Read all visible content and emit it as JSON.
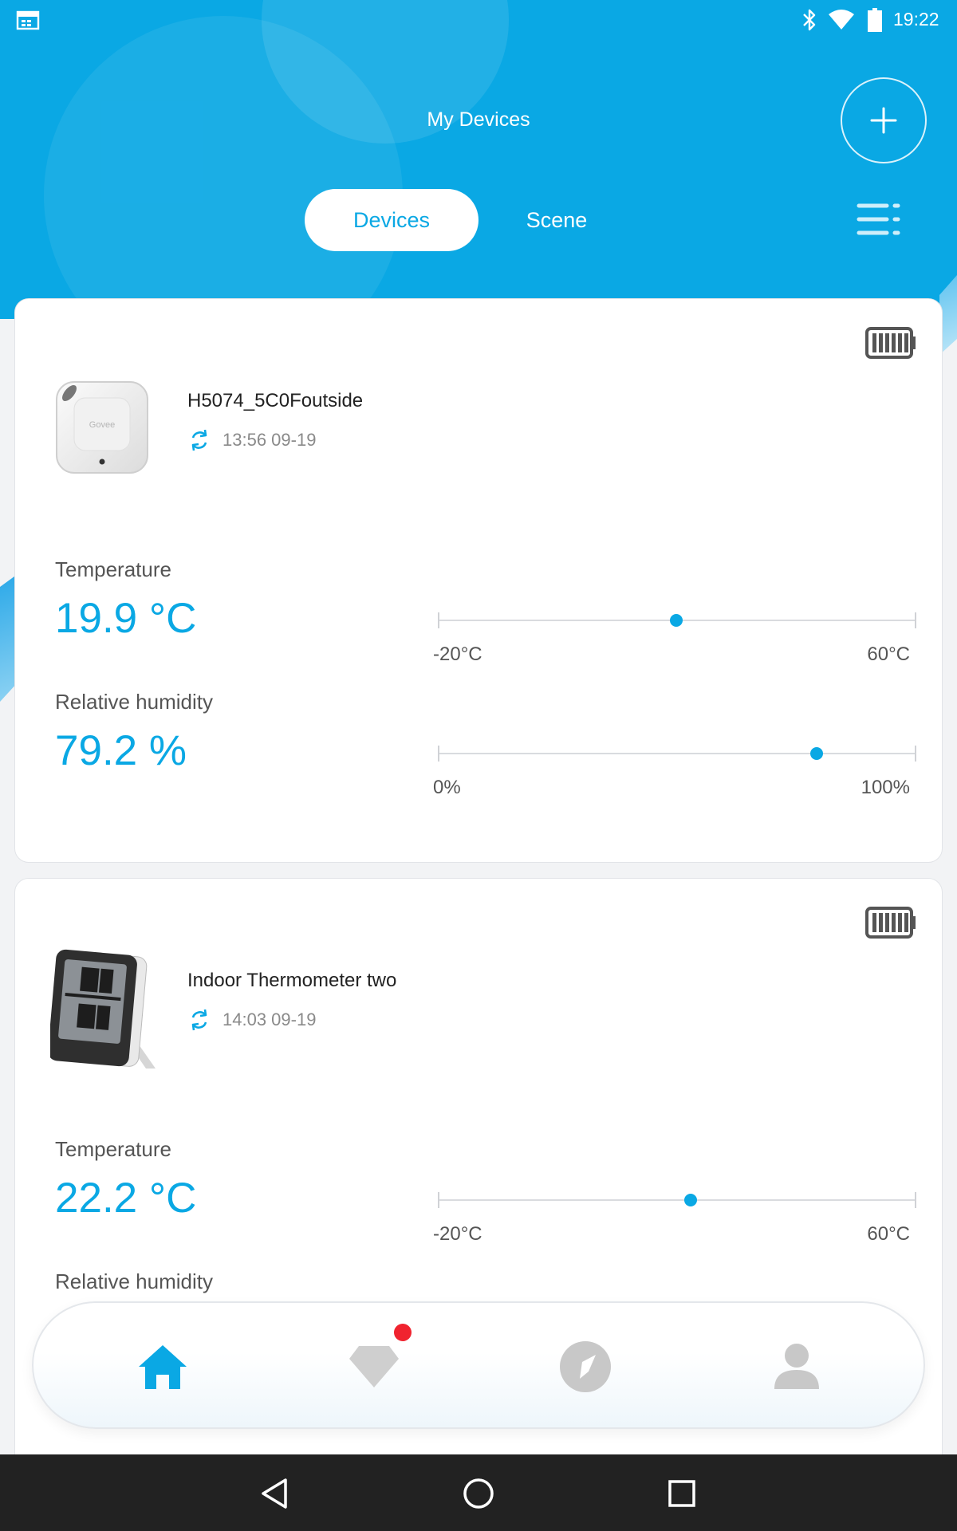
{
  "status_bar": {
    "time": "19:22",
    "icons": [
      "calendar-icon",
      "bluetooth-icon",
      "wifi-icon",
      "battery-icon"
    ]
  },
  "header": {
    "title": "My Devices",
    "add_icon": "plus-icon",
    "menu_icon": "list-menu-icon",
    "tabs": [
      {
        "label": "Devices",
        "active": true
      },
      {
        "label": "Scene",
        "active": false
      }
    ]
  },
  "devices": [
    {
      "name": "H5074_5C0Foutside",
      "sync_time": "13:56 09-19",
      "battery_icon": "battery-full-icon",
      "thumb_label": "Govee",
      "temperature": {
        "label": "Temperature",
        "value": "19.9 °C",
        "numeric": 19.9,
        "min_label": "-20°C",
        "max_label": "60°C",
        "min": -20,
        "max": 60
      },
      "humidity": {
        "label": "Relative humidity",
        "value": "79.2 %",
        "numeric": 79.2,
        "min_label": "0%",
        "max_label": "100%",
        "min": 0,
        "max": 100
      }
    },
    {
      "name": "Indoor Thermometer two",
      "sync_time": "14:03 09-19",
      "battery_icon": "battery-full-icon",
      "temperature": {
        "label": "Temperature",
        "value": "22.2 °C",
        "numeric": 22.2,
        "min_label": "-20°C",
        "max_label": "60°C",
        "min": -20,
        "max": 60
      },
      "humidity": {
        "label": "Relative humidity"
      }
    }
  ],
  "bottom_nav": {
    "items": [
      {
        "icon": "home-icon",
        "active": true
      },
      {
        "icon": "gem-icon",
        "active": false,
        "badge": true
      },
      {
        "icon": "compass-icon",
        "active": false
      },
      {
        "icon": "profile-icon",
        "active": false
      }
    ]
  },
  "colors": {
    "accent": "#0aa8e4",
    "header_bg": "#0aa8e4",
    "inactive_icon": "#c8c8c8",
    "badge": "#f0232f",
    "system_bar": "#222222"
  }
}
